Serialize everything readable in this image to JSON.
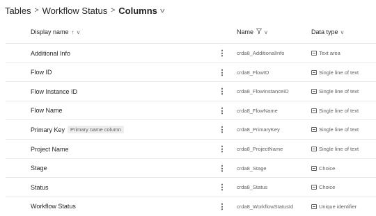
{
  "breadcrumb": {
    "items": [
      "Tables",
      "Workflow Status",
      "Columns"
    ],
    "separator": ">",
    "dropdown_icon": "chevron-down-icon"
  },
  "header": {
    "display_name": "Display name",
    "display_name_sort_icon": "↑",
    "name": "Name",
    "name_filter_icon": "filter-icon",
    "data_type": "Data type"
  },
  "rows": [
    {
      "display_name": "Additional Info",
      "tag": "",
      "logical_name": "crda8_AdditionalInfo",
      "data_type": "Text area",
      "type_icon": "text-area-icon"
    },
    {
      "display_name": "Flow ID",
      "tag": "",
      "logical_name": "crda8_FlowID",
      "data_type": "Single line of text",
      "type_icon": "text-line-icon"
    },
    {
      "display_name": "Flow Instance ID",
      "tag": "",
      "logical_name": "crda8_FlowInstanceID",
      "data_type": "Single line of text",
      "type_icon": "text-line-icon"
    },
    {
      "display_name": "Flow Name",
      "tag": "",
      "logical_name": "crda8_FlowName",
      "data_type": "Single line of text",
      "type_icon": "text-line-icon"
    },
    {
      "display_name": "Primary Key",
      "tag": "Primary name column",
      "logical_name": "crda8_PrimaryKey",
      "data_type": "Single line of text",
      "type_icon": "text-line-icon"
    },
    {
      "display_name": "Project Name",
      "tag": "",
      "logical_name": "crda8_ProjectName",
      "data_type": "Single line of text",
      "type_icon": "text-line-icon"
    },
    {
      "display_name": "Stage",
      "tag": "",
      "logical_name": "crda8_Stage",
      "data_type": "Choice",
      "type_icon": "choice-icon"
    },
    {
      "display_name": "Status",
      "tag": "",
      "logical_name": "crda8_Status",
      "data_type": "Choice",
      "type_icon": "choice-icon"
    },
    {
      "display_name": "Workflow Status",
      "tag": "",
      "logical_name": "crda8_WorkflowStatusId",
      "data_type": "Unique identifier",
      "type_icon": "unique-id-icon"
    }
  ]
}
